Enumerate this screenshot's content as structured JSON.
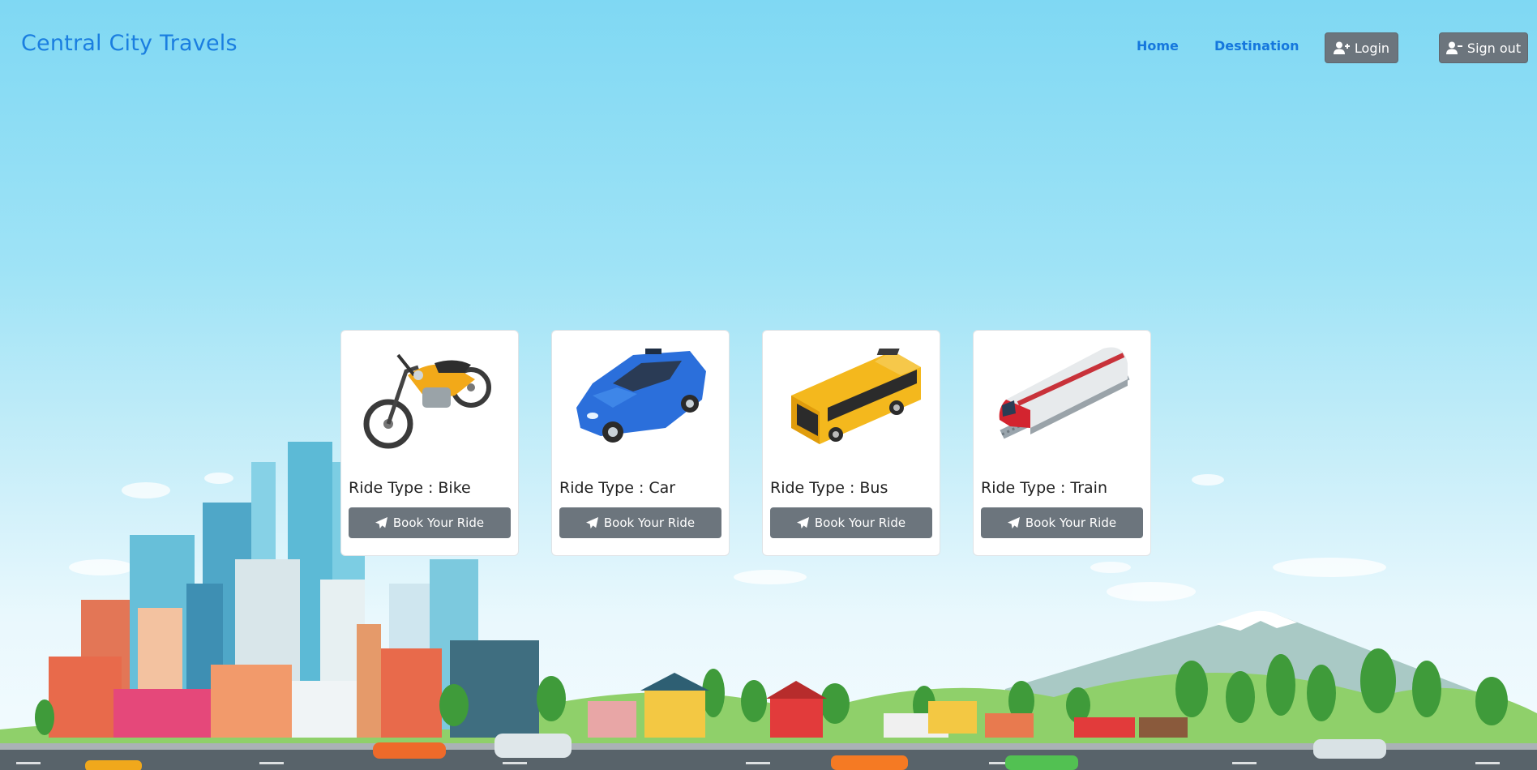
{
  "brand": {
    "title": "Central City Travels"
  },
  "nav": {
    "links": [
      {
        "label": "Home"
      },
      {
        "label": "Destination"
      }
    ],
    "login_label": "Login",
    "signout_label": "Sign out"
  },
  "rides": [
    {
      "title": "Ride Type : Bike",
      "button": "Book Your Ride",
      "icon": "motorcycle-icon"
    },
    {
      "title": "Ride Type : Car",
      "button": "Book Your Ride",
      "icon": "car-icon"
    },
    {
      "title": "Ride Type : Bus",
      "button": "Book Your Ride",
      "icon": "bus-icon"
    },
    {
      "title": "Ride Type : Train",
      "button": "Book Your Ride",
      "icon": "train-icon"
    }
  ],
  "colors": {
    "brand": "#1a7ee0",
    "button": "#6c757d",
    "sky_top": "#7fd8f3"
  }
}
